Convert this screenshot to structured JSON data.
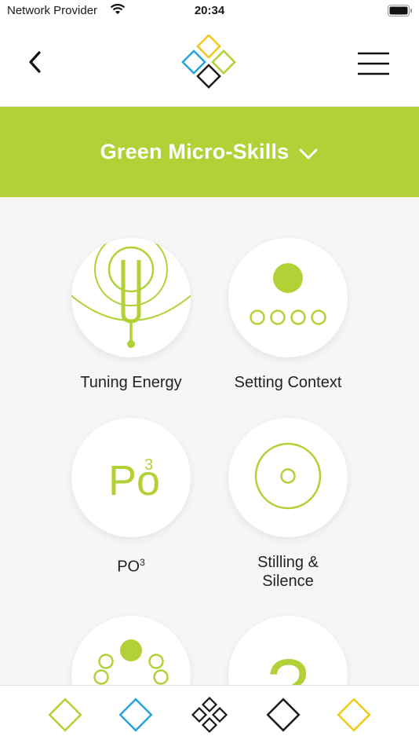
{
  "status_bar": {
    "carrier": "Network Provider",
    "time": "20:34"
  },
  "header": {
    "logo_colors": [
      "#f2c81b",
      "#27a3e0",
      "#b1d136",
      "#1a1a1a"
    ]
  },
  "section": {
    "title": "Green Micro-Skills",
    "color": "#b1d136"
  },
  "skills": [
    {
      "label": "Tuning Energy",
      "icon": "tuning-fork-icon"
    },
    {
      "label": "Setting Context",
      "icon": "dot-row-icon"
    },
    {
      "label": "PO",
      "superscript": "3",
      "icon_text": "Po",
      "icon_sup": "3",
      "icon": "po3-icon"
    },
    {
      "label": "Stilling &\nSilence",
      "icon": "concentric-circle-icon"
    },
    {
      "label": "",
      "icon": "dot-ring-icon"
    },
    {
      "label": "",
      "icon": "question-mark-icon",
      "icon_text": "?"
    }
  ],
  "tabs": [
    {
      "name": "green-tab",
      "color": "#b1d136"
    },
    {
      "name": "blue-tab",
      "color": "#27a3e0"
    },
    {
      "name": "home-tab",
      "color": "#1a1a1a"
    },
    {
      "name": "black-tab",
      "color": "#1a1a1a"
    },
    {
      "name": "yellow-tab",
      "color": "#f2c81b"
    }
  ]
}
